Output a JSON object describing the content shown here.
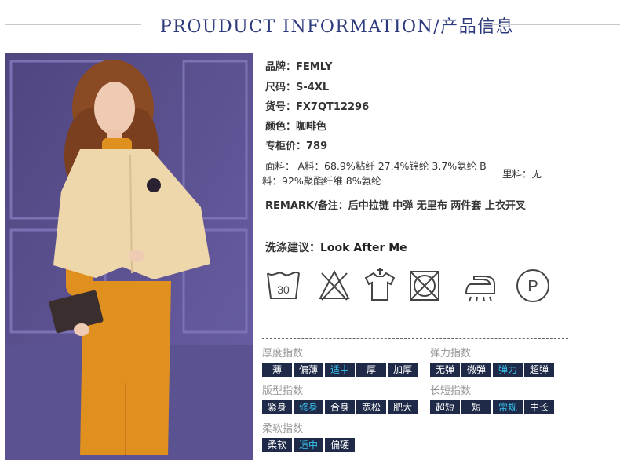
{
  "header": {
    "title": "PROUDUCT INFORMATION/产品信息"
  },
  "photo": {
    "alt": "model"
  },
  "info": {
    "brand": {
      "key": "品牌：",
      "val": "FEMLY"
    },
    "size": {
      "key": "尺码：",
      "val": "S-4XL"
    },
    "sku": {
      "key": "货号：",
      "val": "FX7QT12296"
    },
    "color": {
      "key": "颜色：",
      "val": "咖啡色"
    },
    "price": {
      "key": "专柜价：",
      "val": "789"
    },
    "fabric": {
      "line1": "面料： A料：68.9%粘纤 27.4%锦纶 3.7%氨纶 B",
      "side": "里料：无",
      "line2": "料：92%聚酯纤维 8%氨纶"
    },
    "remark": "REMARK/备注：后中拉链 中弹 无里布 两件套 上衣开叉",
    "wash": {
      "key": "洗涤建议：",
      "val": "Look After Me"
    }
  },
  "care_icons": [
    "wash-30-icon",
    "no-bleach-icon",
    "hang-dry-icon",
    "no-tumble-dry-icon",
    "iron-low-icon",
    "dry-clean-p-icon"
  ],
  "care_text": {
    "wash_temp": "30",
    "dry_clean": "P"
  },
  "indexes": {
    "thickness": {
      "label": "厚度指数",
      "options": [
        "薄",
        "偏薄",
        "适中",
        "厚",
        "加厚"
      ],
      "selected": 2
    },
    "elasticity": {
      "label": "弹力指数",
      "options": [
        "无弹",
        "微弹",
        "弹力",
        "超弹"
      ],
      "selected": 2
    },
    "fit": {
      "label": "版型指数",
      "options": [
        "紧身",
        "修身",
        "合身",
        "宽松",
        "肥大"
      ],
      "selected": 1
    },
    "length": {
      "label": "长短指数",
      "options": [
        "超短",
        "短",
        "常规",
        "中长"
      ],
      "selected": 2
    },
    "softness": {
      "label": "柔软指数",
      "options": [
        "柔软",
        "适中",
        "偏硬"
      ],
      "selected": 1
    }
  },
  "colors": {
    "title": "#2d3a7c",
    "cell_bg": "#1e2a48",
    "cell_on": "#38c4ee",
    "photo_bg": "#5a4f8e"
  }
}
